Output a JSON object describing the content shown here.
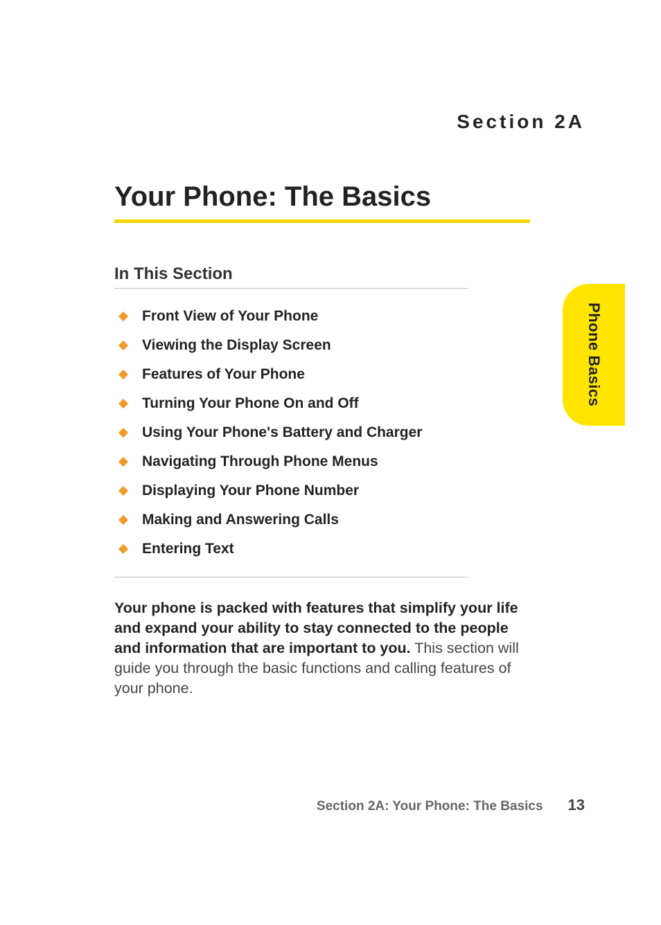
{
  "header": {
    "section_label": "Section 2A"
  },
  "title": "Your Phone: The Basics",
  "subheading": "In This Section",
  "toc": [
    "Front View of Your Phone",
    "Viewing the Display Screen",
    "Features of Your Phone",
    "Turning Your Phone On and Off",
    "Using Your Phone's Battery and Charger",
    "Navigating Through Phone Menus",
    "Displaying Your Phone Number",
    "Making and Answering Calls",
    "Entering Text"
  ],
  "body": {
    "lead": "Your phone is packed with features that simplify your life and expand your ability to stay connected to the people and information that are important to you.",
    "rest": " This section will guide you through the basic functions and calling features of your phone."
  },
  "sidetab": "Phone Basics",
  "footer": {
    "title": "Section 2A: Your Phone: The Basics",
    "page": "13"
  }
}
